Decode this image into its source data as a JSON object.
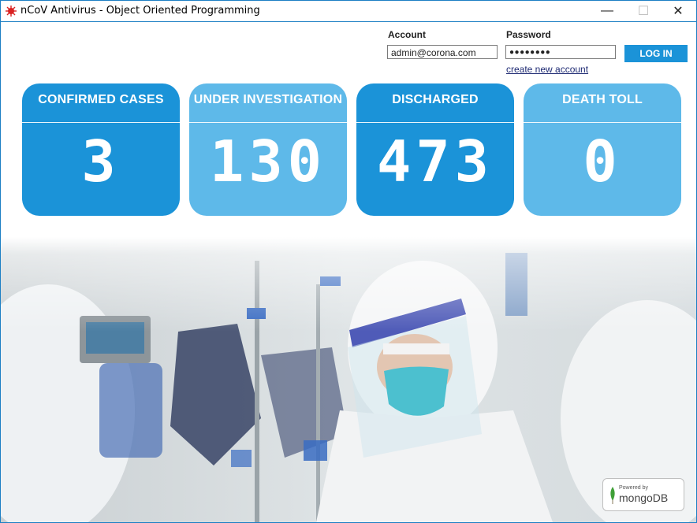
{
  "window": {
    "title": "nCoV Antivirus - Object Oriented Programming",
    "controls": {
      "minimize": "—",
      "maximize": "☐",
      "close": "✕"
    }
  },
  "login": {
    "account_label": "Account",
    "account_value": "admin@corona.com",
    "password_label": "Password",
    "password_value": "●●●●●●●●",
    "login_button": "LOG IN",
    "create_link": "create new account"
  },
  "stats": [
    {
      "label": "CONFIRMED CASES",
      "value": "3"
    },
    {
      "label": "UNDER INVESTIGATION",
      "value": "130"
    },
    {
      "label": "DISCHARGED",
      "value": "473"
    },
    {
      "label": "DEATH TOLL",
      "value": "0"
    }
  ],
  "footer": {
    "powered_by": "Powered by",
    "brand": "mongoDB"
  },
  "colors": {
    "card_dark": "#1b93d8",
    "card_light": "#5eb9e9",
    "login_button": "#1b93d8",
    "window_border": "#1c7fc4"
  },
  "icons": {
    "app": "virus-icon",
    "background": "medical-worker-photo",
    "brand": "mongodb-leaf-icon"
  }
}
